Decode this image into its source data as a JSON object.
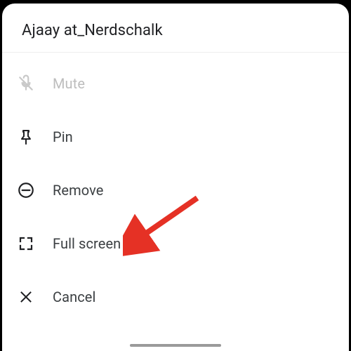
{
  "header": {
    "title": "Ajaay at_Nerdschalk"
  },
  "menu": {
    "mute": {
      "label": "Mute",
      "icon": "mic-off-icon",
      "enabled": false
    },
    "pin": {
      "label": "Pin",
      "icon": "pin-icon",
      "enabled": true
    },
    "remove": {
      "label": "Remove",
      "icon": "remove-icon",
      "enabled": true
    },
    "fullscreen": {
      "label": "Full screen",
      "icon": "fullscreen-icon",
      "enabled": true
    },
    "cancel": {
      "label": "Cancel",
      "icon": "close-icon",
      "enabled": true
    }
  },
  "colors": {
    "disabled": "#bdbdbd",
    "text": "#3c4043",
    "icon": "#202124",
    "arrow": "#e53125"
  }
}
